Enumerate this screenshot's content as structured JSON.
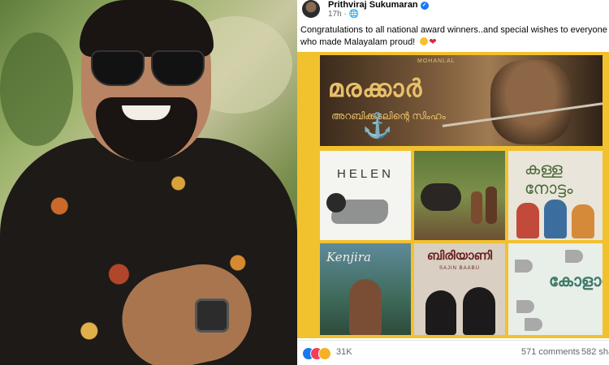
{
  "post": {
    "author": "Prithviraj Sukumaran",
    "time": "17h",
    "caption": "Congratulations to all national award winners..and special wishes to everyone who made Malayalam proud!",
    "posters": {
      "marakkar_title": "മരക്കാർ",
      "marakkar_subtitle": "അറബിക്കടലിന്റെ സിംഹം",
      "marakkar_producer": "MOHANLAL",
      "helen_title": "HELEN",
      "kids_title": "കള്ള നോട്ടം",
      "kenjira_title": "Kenjira",
      "biriyani_title": "ബിരിയാണി",
      "biriyani_sub": "SAJIN BAABU",
      "kolambi_title": "കോളാമ്പി"
    },
    "stats": {
      "reactions": "31K",
      "comments": "571 comments",
      "shares": "582 sha"
    }
  },
  "icons": [
    "verified-icon",
    "globe-icon",
    "smile-emoji",
    "heart-emoji",
    "like-reaction-icon",
    "love-reaction-icon",
    "haha-reaction-icon"
  ],
  "colors": {
    "facebook_blue": "#1877f2",
    "collage_border": "#f2c12e",
    "meta_gray": "#65676b"
  }
}
